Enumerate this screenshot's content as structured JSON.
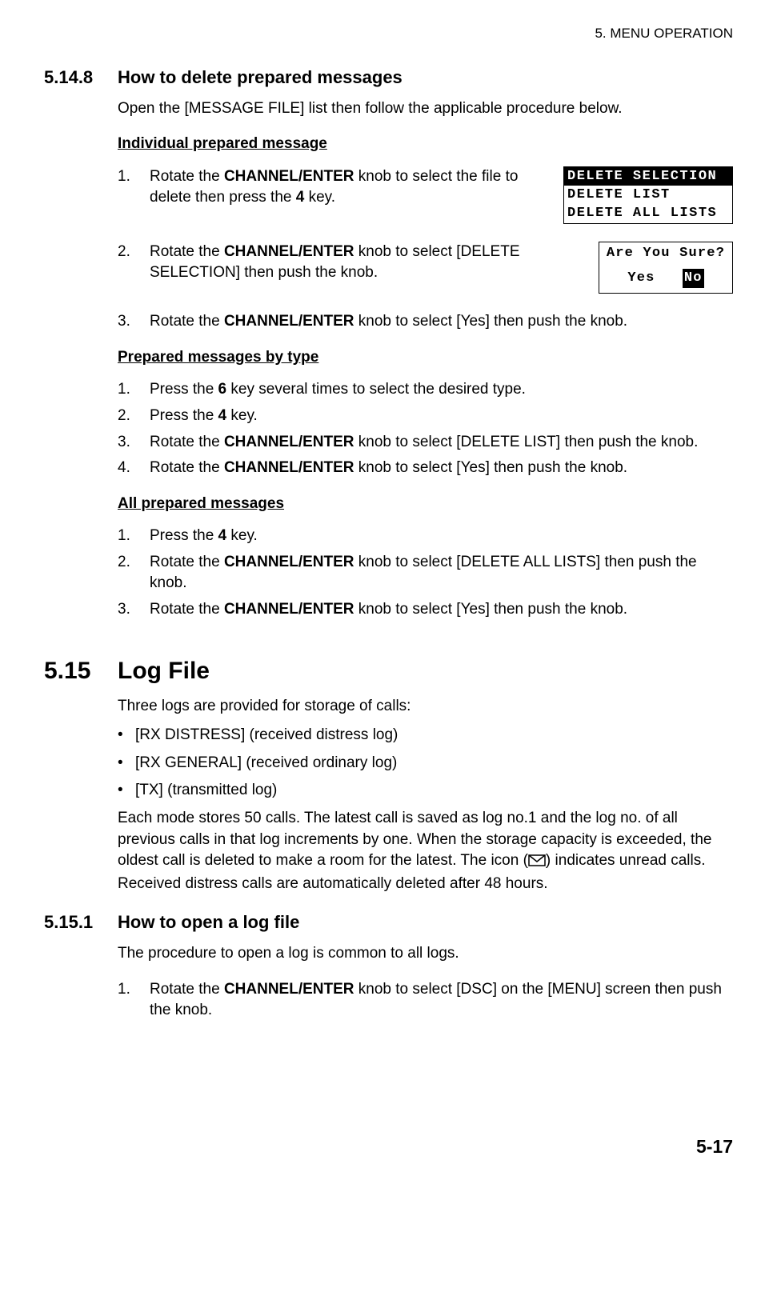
{
  "header": {
    "chapter": "5.  MENU OPERATION"
  },
  "sec1": {
    "num": "5.14.8",
    "title": "How to delete prepared messages",
    "intro": "Open the [MESSAGE FILE] list then follow the applicable procedure below.",
    "sub1": {
      "heading": "Individual prepared message",
      "step1_a": "Rotate the ",
      "step1_b": "CHANNEL/ENTER",
      "step1_c": " knob to select the file to delete then press the ",
      "step1_d": "4",
      "step1_e": " key.",
      "step2_a": "Rotate the ",
      "step2_b": "CHANNEL/ENTER",
      "step2_c": " knob to select [DELETE SELECTION] then push the knob.",
      "step3_a": "Rotate the ",
      "step3_b": "CHANNEL/ENTER",
      "step3_c": " knob to select [Yes] then push the knob."
    },
    "lcd1": {
      "r1": "DELETE SELECTION",
      "r2": "DELETE LIST",
      "r3": "DELETE ALL LISTS"
    },
    "lcd2": {
      "line1": "Are You Sure?",
      "yes": "Yes",
      "no": "No"
    },
    "sub2": {
      "heading": "Prepared messages by type",
      "s1_a": "Press the ",
      "s1_b": "6",
      "s1_c": " key several times to select the desired type.",
      "s2_a": "Press the ",
      "s2_b": "4",
      "s2_c": " key.",
      "s3_a": "Rotate the ",
      "s3_b": "CHANNEL/ENTER",
      "s3_c": " knob to select [DELETE LIST] then push the knob.",
      "s4_a": "Rotate the ",
      "s4_b": "CHANNEL/ENTER",
      "s4_c": " knob to select [Yes] then push the knob."
    },
    "sub3": {
      "heading": "All prepared messages",
      "s1_a": "Press the ",
      "s1_b": "4",
      "s1_c": " key.",
      "s2_a": "Rotate the ",
      "s2_b": "CHANNEL/ENTER",
      "s2_c": " knob to select [DELETE ALL LISTS] then push the knob.",
      "s3_a": "Rotate the ",
      "s3_b": "CHANNEL/ENTER",
      "s3_c": " knob to select [Yes] then push the knob."
    }
  },
  "sec2": {
    "num": "5.15",
    "title": "Log File",
    "intro": "Three logs are provided for storage of calls:",
    "b1": "[RX DISTRESS] (received distress log)",
    "b2": "[RX GENERAL] (received ordinary log)",
    "b3": "[TX] (transmitted log)",
    "para_a": "Each mode stores 50 calls. The latest call is saved as log no.1 and the log no. of all previous calls in that log increments by one. When the storage capacity is exceeded, the oldest call is deleted to make a room for the latest. The icon (",
    "para_b": ") indicates unread calls. Received distress calls are automatically deleted after 48 hours."
  },
  "sec3": {
    "num": "5.15.1",
    "title": "How to open a log file",
    "intro": "The procedure to open a log is common to all logs.",
    "s1_a": "Rotate the ",
    "s1_b": "CHANNEL/ENTER",
    "s1_c": " knob to select [DSC] on the [MENU] screen then push the knob."
  },
  "steps": {
    "n1": "1.",
    "n2": "2.",
    "n3": "3.",
    "n4": "4."
  },
  "bullet": "•",
  "page_number": "5-17"
}
